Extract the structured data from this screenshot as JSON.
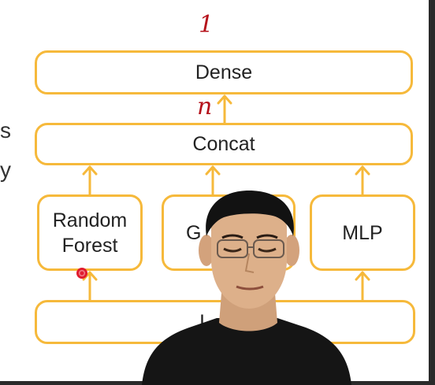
{
  "diagram": {
    "blocks": {
      "dense": "Dense",
      "concat": "Concat",
      "random_forest_line1": "Random",
      "random_forest_line2": "Forest",
      "gbdt_partial": "G",
      "mlp": "MLP",
      "input_partial": "I"
    },
    "edge_letters": [
      "s",
      "y"
    ],
    "annotations": {
      "top_mark": "1",
      "between_mark": "n"
    },
    "accent_color": "#f6b93b",
    "ink_color": "#b5121b"
  }
}
